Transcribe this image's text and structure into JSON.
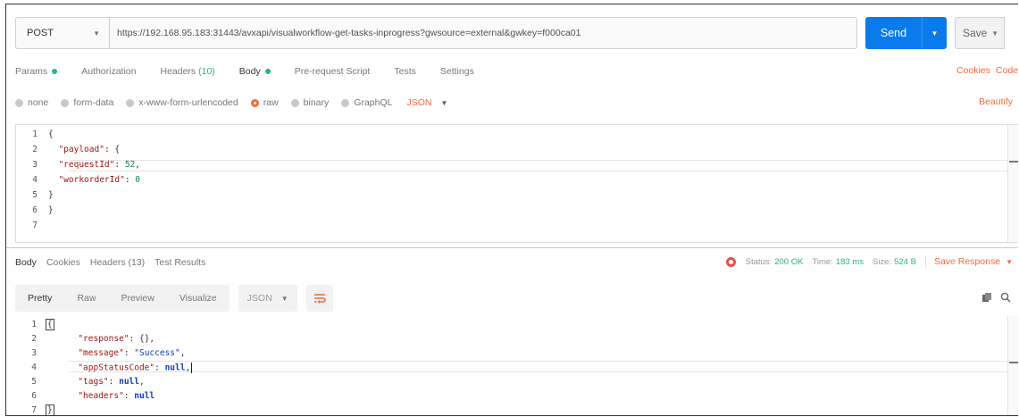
{
  "request": {
    "method": "POST",
    "url": "https://192.168.95.183:31443/avxapi/visualworkflow-get-tasks-inprogress?gwsource=external&gwkey=f000ca01",
    "send_label": "Send",
    "save_label": "Save"
  },
  "request_tabs": {
    "params": "Params",
    "authorization": "Authorization",
    "headers": "Headers",
    "headers_count": "(10)",
    "body": "Body",
    "prerequest": "Pre-request Script",
    "tests": "Tests",
    "settings": "Settings",
    "cookies": "Cookies",
    "code": "Code"
  },
  "body_types": {
    "none": "none",
    "form_data": "form-data",
    "urlencoded": "x-www-form-urlencoded",
    "raw": "raw",
    "binary": "binary",
    "graphql": "GraphQL",
    "format": "JSON",
    "beautify": "Beautify"
  },
  "request_body": {
    "lines": [
      "1",
      "2",
      "3",
      "4",
      "5",
      "6",
      "7"
    ],
    "l1": "{",
    "l2_key": "\"payload\"",
    "l2_rest": ": {",
    "l3_key": "\"requestId\"",
    "l3_sep": ": ",
    "l3_val": "52",
    "l3_end": ",",
    "l4_key": "\"workorderId\"",
    "l4_sep": ": ",
    "l4_val": "0",
    "l5": "}",
    "l6": "}"
  },
  "response_tabs": {
    "body": "Body",
    "cookies": "Cookies",
    "headers": "Headers (13)",
    "test_results": "Test Results"
  },
  "response_status": {
    "status_label": "Status:",
    "status_value": "200 OK",
    "time_label": "Time:",
    "time_value": "183 ms",
    "size_label": "Size:",
    "size_value": "524 B",
    "save_response": "Save Response"
  },
  "response_toolbar": {
    "pretty": "Pretty",
    "raw": "Raw",
    "preview": "Preview",
    "visualize": "Visualize",
    "format": "JSON"
  },
  "response_body": {
    "lines": [
      "1",
      "2",
      "3",
      "4",
      "5",
      "6",
      "7"
    ],
    "l1": "{",
    "l2_key": "\"response\"",
    "l2_rest": ": {},",
    "l3_key": "\"message\"",
    "l3_sep": ": ",
    "l3_val": "\"Success\"",
    "l3_end": ",",
    "l4_key": "\"appStatusCode\"",
    "l4_sep": ": ",
    "l4_val": "null",
    "l4_end": ",",
    "l5_key": "\"tags\"",
    "l5_sep": ": ",
    "l5_val": "null",
    "l5_end": ",",
    "l6_key": "\"headers\"",
    "l6_sep": ": ",
    "l6_val": "null",
    "l7": "}"
  },
  "colors": {
    "accent": "#f26b3a",
    "send": "#097bed",
    "status_ok": "#26b47f"
  },
  "icons": {
    "method_caret": "chevron-down-icon",
    "status_globe": "globe-icon",
    "wrap": "wrap-lines-icon",
    "copy": "copy-icon",
    "search": "search-icon"
  }
}
